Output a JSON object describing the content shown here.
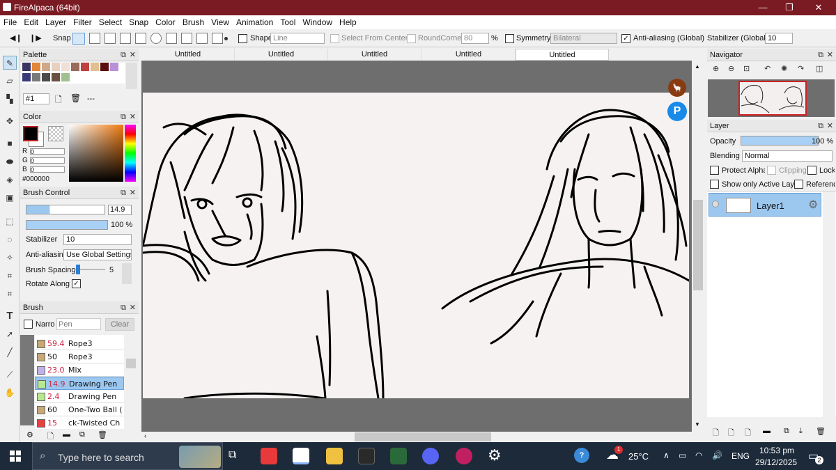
{
  "window": {
    "title": "FireAlpaca (64bit)"
  },
  "menu": [
    "File",
    "Edit",
    "Layer",
    "Filter",
    "Select",
    "Snap",
    "Color",
    "Brush",
    "View",
    "Animation",
    "Tool",
    "Window",
    "Help"
  ],
  "toolbar": {
    "snap_label": "Snap",
    "shape_label": "Shape",
    "shape_value": "Line",
    "select_center_label": "Select From Center",
    "roundcorner_label": "RoundCorner",
    "roundcorner_value": "80",
    "percent": "%",
    "symmetry_label": "Symmetry",
    "symmetry_value": "Bilateral",
    "antialias_label": "Anti-aliasing (Global)",
    "stabilizer_label": "Stabilizer (Global)",
    "stabilizer_value": "10"
  },
  "palette": {
    "title": "Palette",
    "selector": "#1",
    "dashes": "---",
    "colors": [
      "#3a3560",
      "#e2863a",
      "#cfa88a",
      "#e8d0c0",
      "#f0e0d8",
      "#9a6a5a",
      "#c04040",
      "#e0c090",
      "#5a1010",
      "#b890d8",
      "#3a3a7a",
      "#7a7a7a",
      "#4a4a4a",
      "#6a5040",
      "#a0c090"
    ]
  },
  "color": {
    "title": "Color",
    "r_label": "R",
    "r_value": "0",
    "g_label": "G",
    "g_value": "0",
    "b_label": "B",
    "b_value": "0",
    "hex": "#000000"
  },
  "brush_control": {
    "title": "Brush Control",
    "size": "14.9",
    "opacity": "100 %",
    "stabilizer_label": "Stabilizer",
    "stabilizer_value": "10",
    "antialias_label": "Anti-aliasin",
    "antialias_value": "Use Global Settings",
    "spacing_label": "Brush Spacing",
    "spacing_value": "5",
    "rotate_label": "Rotate Along"
  },
  "brush": {
    "title": "Brush",
    "narrow_label": "Narro",
    "search_placeholder": "Pen",
    "clear_label": "Clear",
    "items": [
      {
        "size": "59.4",
        "name": "Rope3",
        "color": "#c8a878"
      },
      {
        "size": "50",
        "name": "Rope3",
        "color": "#c8a878"
      },
      {
        "size": "23.0",
        "name": "Mix",
        "color": "#c0b0e8"
      },
      {
        "size": "14.9",
        "name": "Drawing Pen",
        "color": "#b8e890"
      },
      {
        "size": "2.4",
        "name": "Drawing Pen",
        "color": "#b8e890"
      },
      {
        "size": "60",
        "name": "One-Two Ball (",
        "color": "#c8a878"
      },
      {
        "size": "15",
        "name": "ck-Twisted Ch",
        "color": "#e84040"
      }
    ]
  },
  "tabs": [
    "Untitled",
    "Untitled",
    "Untitled",
    "Untitled",
    "Untitled"
  ],
  "navigator": {
    "title": "Navigator"
  },
  "layer": {
    "title": "Layer",
    "opacity_label": "Opacity",
    "opacity_value": "100 %",
    "blending_label": "Blending",
    "blending_value": "Normal",
    "protect_alpha": "Protect Alpha",
    "clipping": "Clipping",
    "lock": "Lock",
    "show_active": "Show only Active Layer",
    "reference": "Reference",
    "layer_name": "Layer1"
  },
  "taskbar": {
    "search_placeholder": "Type here to search",
    "temperature": "25°C",
    "language": "ENG",
    "time": "10:53 pm",
    "date": "29/12/2025",
    "notifications": "2",
    "weather_badge": "1"
  }
}
